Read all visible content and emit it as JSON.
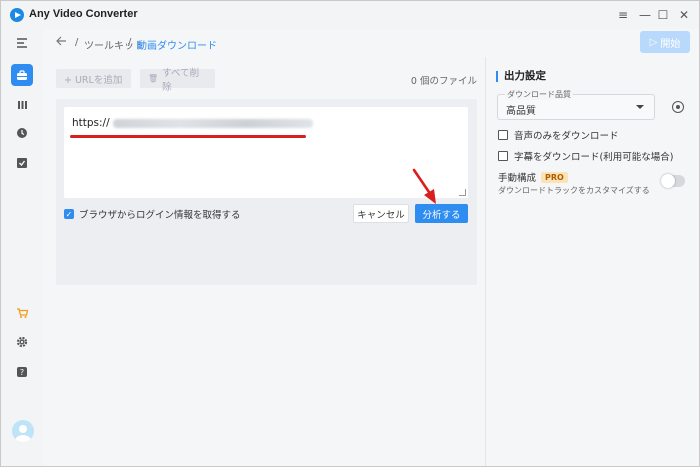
{
  "app": {
    "title": "Any Video Converter"
  },
  "window_controls": {
    "menu": "≡",
    "minimize": "—",
    "maximize": "☐",
    "close": "✕"
  },
  "breadcrumb": {
    "sep1": "/",
    "tools": "ツールキット",
    "sep2": "/",
    "current": "動画ダウンロード"
  },
  "start_button": {
    "icon": "▷",
    "label": "開始"
  },
  "toolbar": {
    "add_url": "+ URLを追加",
    "delete_all_icon": "🗑",
    "delete_all": "すべて削除",
    "file_count": "0 個のファイル"
  },
  "url_input": {
    "value": "https://"
  },
  "login_checkbox": {
    "label": "ブラウザからログイン情報を取得する",
    "checked": true
  },
  "buttons": {
    "cancel": "キャンセル",
    "analyze": "分析する"
  },
  "output_settings": {
    "title": "出力設定",
    "quality_label": "ダウンロード品質",
    "quality_value": "高品質",
    "audio_only": "音声のみをダウンロード",
    "subtitles": "字幕をダウンロード(利用可能な場合)",
    "manual_title": "手動構成",
    "pro_badge": "PRO",
    "manual_desc": "ダウンロードトラックをカスタマイズする",
    "manual_enabled": false
  },
  "colors": {
    "accent": "#2f8cf0",
    "annotation_red": "#d81e1e"
  }
}
